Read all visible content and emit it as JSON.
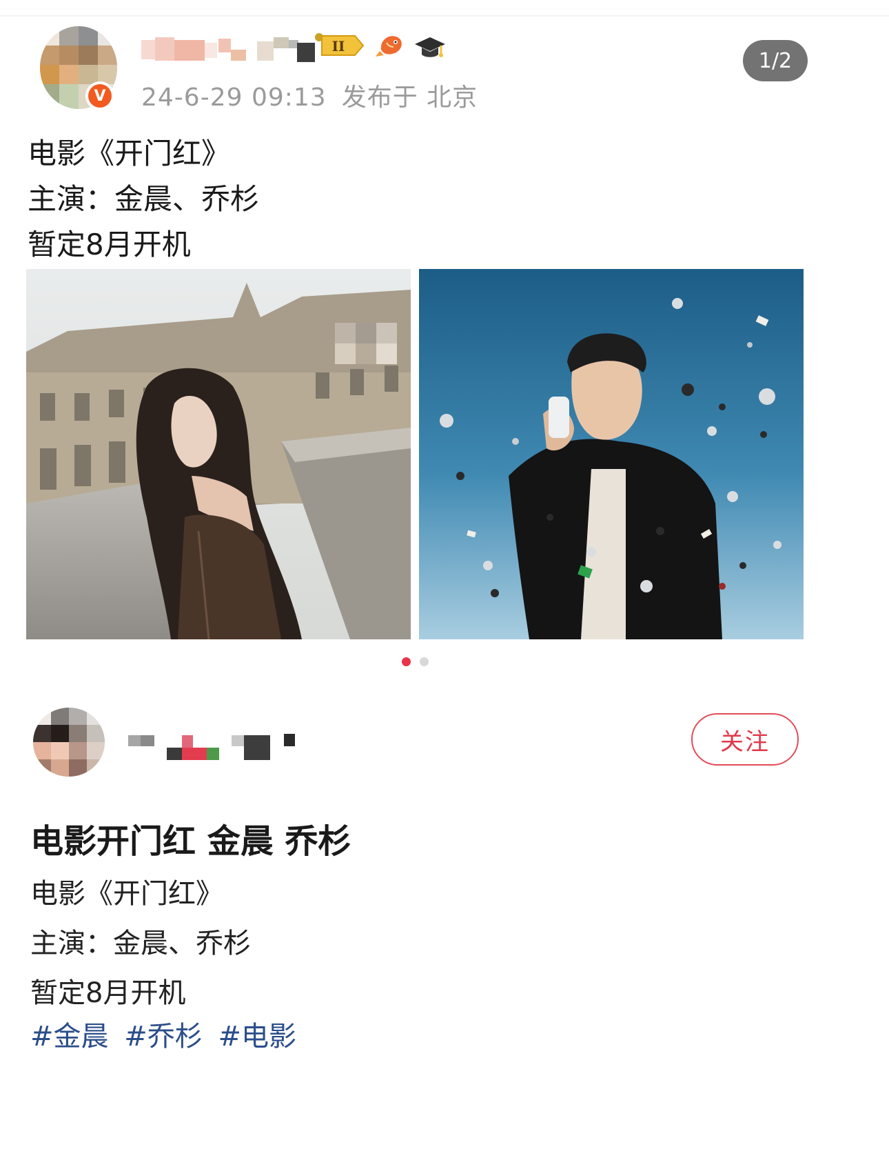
{
  "post": {
    "timestamp": "24-6-29 09:13",
    "location": "发布于 北京",
    "lines": [
      "电影《开门红》",
      "主演：金晨、乔杉",
      "暂定8月开机"
    ],
    "image_pager": "1/2",
    "level_badge": "II",
    "verified_mark": "V"
  },
  "article": {
    "follow_label": "关注",
    "title": "电影开门红 金晨 乔杉",
    "lines": [
      "电影《开门红》",
      "主演：金晨、乔杉",
      "暂定8月开机"
    ],
    "hashtags": [
      "#金晨",
      "#乔杉",
      "#电影"
    ]
  },
  "colors": {
    "accent": "#e0384a",
    "hashtag": "#2b4d8a",
    "meta_gray": "#9a9a9a",
    "pager_bg": "#737373"
  },
  "icons": [
    "verified-v-icon",
    "level-badge-icon",
    "fish-icon",
    "graduation-cap-icon"
  ]
}
